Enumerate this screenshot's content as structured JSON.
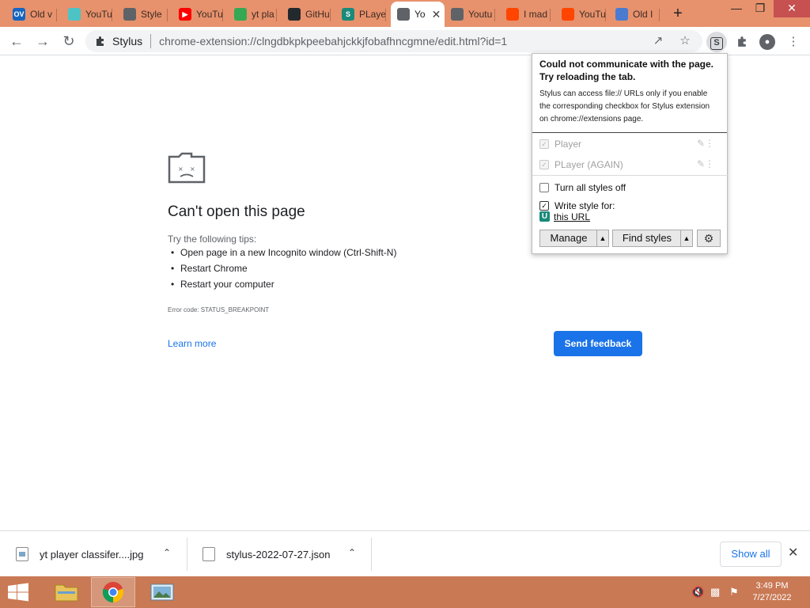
{
  "tabs": [
    {
      "label": "Old v",
      "favicon": "ov-icon",
      "fav_text": "OV",
      "fav_color": "#1565c0"
    },
    {
      "label": "YouTu",
      "favicon": "face-icon",
      "fav_text": "",
      "fav_color": "#4dc3c6"
    },
    {
      "label": "Style",
      "favicon": "sad-tab-icon",
      "fav_text": "",
      "fav_color": "#5f6368"
    },
    {
      "label": "YouTu",
      "favicon": "youtube-icon",
      "fav_text": "▶",
      "fav_color": "#ff0000"
    },
    {
      "label": "yt pla",
      "favicon": "drive-icon",
      "fav_text": "",
      "fav_color": "#34a853"
    },
    {
      "label": "GitHu",
      "favicon": "github-icon",
      "fav_text": "",
      "fav_color": "#24292e"
    },
    {
      "label": "PLaye",
      "favicon": "stylus-s-icon",
      "fav_text": "S",
      "fav_color": "#1a8a7a"
    },
    {
      "label": "Yo",
      "favicon": "sad-tab-icon",
      "fav_text": "",
      "fav_color": "#5f6368",
      "active": true
    },
    {
      "label": "Youtu",
      "favicon": "sad-tab-icon",
      "fav_text": "",
      "fav_color": "#5f6368"
    },
    {
      "label": "I mad",
      "favicon": "reddit-icon",
      "fav_text": "",
      "fav_color": "#ff4500"
    },
    {
      "label": "YouTu",
      "favicon": "reddit-icon",
      "fav_text": "",
      "fav_color": "#ff4500"
    },
    {
      "label": "Old I",
      "favicon": "loading-icon",
      "fav_text": "",
      "fav_color": "#4a7bd0"
    }
  ],
  "toolbar": {
    "extension_name": "Stylus",
    "url": "chrome-extension://clngdbkpkpeebahjckkjfobafhncgmne/edit.html?id=1"
  },
  "error_page": {
    "title": "Can't open this page",
    "tips_intro": "Try the following tips:",
    "tips": [
      "Open page in a new Incognito window (Ctrl-Shift-N)",
      "Restart Chrome",
      "Restart your computer"
    ],
    "error_code": "Error code: STATUS_BREAKPOINT",
    "learn_more": "Learn more",
    "send_feedback": "Send feedback"
  },
  "popup": {
    "warning_title": "Could not communicate with the page. Try reloading the tab.",
    "warning_body": "Stylus can access file:// URLs only if you enable the corresponding checkbox for Stylus extension on chrome://extensions page.",
    "styles": [
      {
        "name": "Player",
        "enabled": true
      },
      {
        "name": "PLayer (AGAIN)",
        "enabled": true
      }
    ],
    "turn_all_off": "Turn all styles off",
    "write_style_for": "Write style for:",
    "this_url": "this URL",
    "this_url_badge": "U",
    "manage": "Manage",
    "find_styles": "Find styles",
    "accent_color": "#1a8a7a"
  },
  "downloads": [
    {
      "name": "yt player classifer....jpg",
      "type": "image"
    },
    {
      "name": "stylus-2022-07-27.json",
      "type": "file"
    }
  ],
  "show_all": "Show all",
  "taskbar": {
    "time": "3:49 PM",
    "date": "7/27/2022"
  }
}
